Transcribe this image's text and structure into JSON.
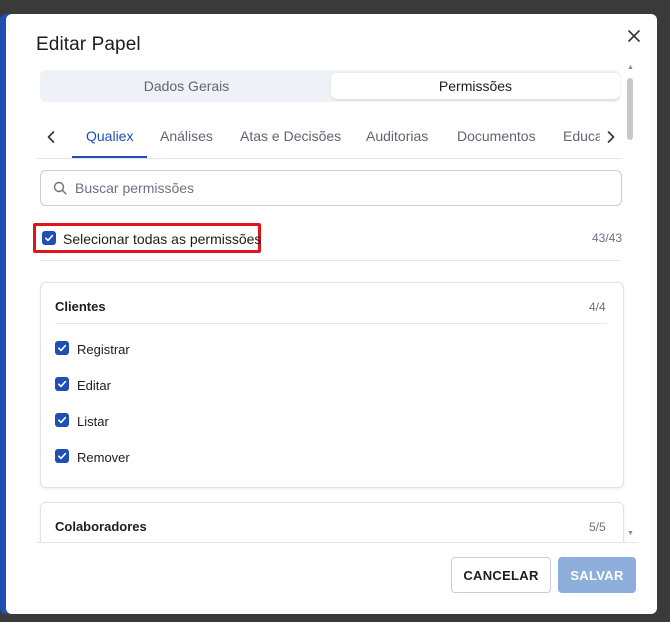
{
  "dialog": {
    "title": "Editar Papel",
    "close_icon": "close-icon"
  },
  "segmented": {
    "tabs": [
      {
        "label": "Dados Gerais",
        "active": false
      },
      {
        "label": "Permissões",
        "active": true
      }
    ]
  },
  "module_tabs": {
    "items": [
      {
        "label": "Qualiex",
        "active": true
      },
      {
        "label": "Análises",
        "active": false
      },
      {
        "label": "Atas e Decisões",
        "active": false
      },
      {
        "label": "Auditorias",
        "active": false
      },
      {
        "label": "Documentos",
        "active": false
      },
      {
        "label": "Educaç",
        "active": false
      }
    ],
    "prev_icon": "chevron-left-icon",
    "next_icon": "chevron-right-icon"
  },
  "search": {
    "placeholder": "Buscar permissões",
    "value": "",
    "icon": "search-icon"
  },
  "select_all": {
    "label": "Selecionar todas as permissões",
    "checked": true,
    "count": "43/43"
  },
  "groups": [
    {
      "title": "Clientes",
      "count": "4/4",
      "permissions": [
        {
          "label": "Registrar",
          "checked": true
        },
        {
          "label": "Editar",
          "checked": true
        },
        {
          "label": "Listar",
          "checked": true
        },
        {
          "label": "Remover",
          "checked": true
        }
      ]
    },
    {
      "title": "Colaboradores",
      "count": "5/5",
      "permissions": []
    }
  ],
  "footer": {
    "cancel_label": "CANCELAR",
    "save_label": "SALVAR"
  },
  "colors": {
    "accent": "#1f4fb5",
    "highlight_border": "#e0141e",
    "save_disabled": "#8eaedc"
  }
}
